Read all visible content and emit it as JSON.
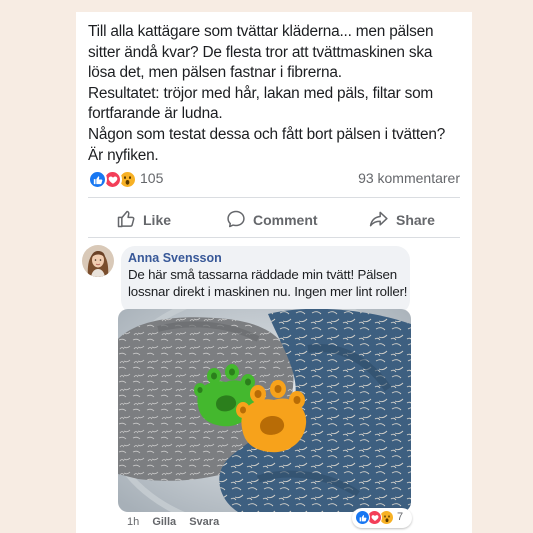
{
  "post": {
    "text_lines": [
      "Till alla kattägare som tvättar kläderna... men pälsen",
      "sitter ändå kvar? De flesta tror att tvättmaskinen ska",
      "lösa det, men pälsen fastnar i fibrerna.",
      "Resultatet: tröjor med hår, lakan med päls, filtar som",
      "fortfarande är ludna.",
      "Någon som testat dessa och fått bort pälsen i tvätten?",
      "Är nyfiken."
    ],
    "reactions": {
      "icons": [
        "like-icon",
        "love-icon",
        "wow-icon"
      ],
      "count": "105"
    },
    "comments_count": "93 kommentarer"
  },
  "actions": {
    "like": {
      "label": "Like",
      "icon": "thumbs-up-icon"
    },
    "comment": {
      "label": "Comment",
      "icon": "speech-bubble-icon"
    },
    "share": {
      "label": "Share",
      "icon": "share-arrow-icon"
    }
  },
  "comment": {
    "author": "Anna Svensson",
    "text_lines": [
      "De här små tassarna räddade min tvätt! Pälsen",
      "lossnar direkt i maskinen nu. Ingen mer lint roller!"
    ],
    "meta": {
      "time": "1h",
      "like_label": "Gilla",
      "reply_label": "Svara"
    },
    "reactions": {
      "icons": [
        "like-icon",
        "love-icon",
        "wow-icon"
      ],
      "count": "7"
    }
  },
  "colors": {
    "background": "#f7ece3",
    "facebook_blue": "#1877f2",
    "love_red": "#f33e58",
    "wow_yellow": "#f7b125",
    "author_blue": "#385898",
    "muted_gray": "#65676b",
    "paw_green": "#44b82e",
    "paw_orange": "#f7a21b"
  }
}
